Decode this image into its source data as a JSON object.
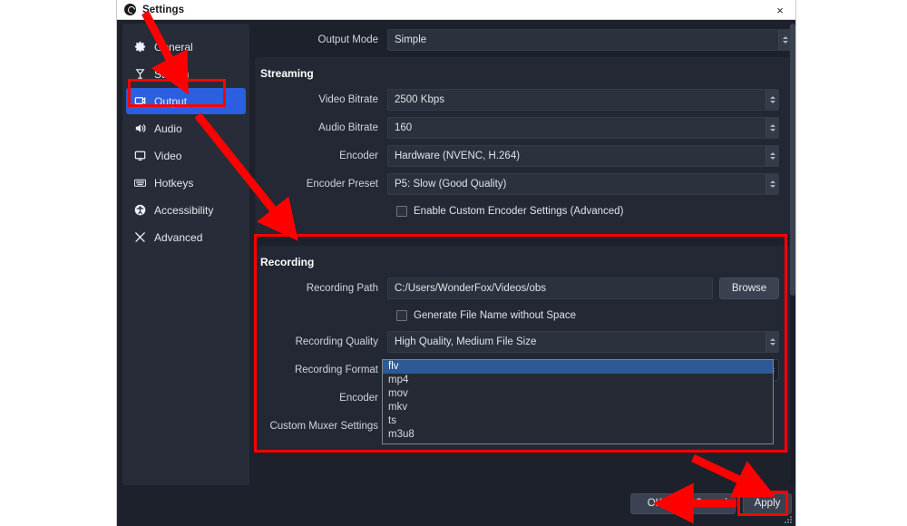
{
  "window": {
    "title": "Settings",
    "close_label": "×",
    "app_icon": "obs-logo-icon"
  },
  "sidebar": {
    "items": [
      {
        "label": "General",
        "icon": "gear-icon",
        "selected": false
      },
      {
        "label": "Stream",
        "icon": "broadcast-icon",
        "selected": false
      },
      {
        "label": "Output",
        "icon": "output-screen-icon",
        "selected": true
      },
      {
        "label": "Audio",
        "icon": "speaker-icon",
        "selected": false
      },
      {
        "label": "Video",
        "icon": "monitor-icon",
        "selected": false
      },
      {
        "label": "Hotkeys",
        "icon": "keyboard-icon",
        "selected": false
      },
      {
        "label": "Accessibility",
        "icon": "accessibility-icon",
        "selected": false
      },
      {
        "label": "Advanced",
        "icon": "tools-icon",
        "selected": false
      }
    ]
  },
  "output_mode": {
    "label": "Output Mode",
    "value": "Simple"
  },
  "streaming": {
    "heading": "Streaming",
    "video_bitrate": {
      "label": "Video Bitrate",
      "value": "2500 Kbps"
    },
    "audio_bitrate": {
      "label": "Audio Bitrate",
      "value": "160"
    },
    "encoder": {
      "label": "Encoder",
      "value": "Hardware (NVENC, H.264)"
    },
    "encoder_preset": {
      "label": "Encoder Preset",
      "value": "P5: Slow (Good Quality)"
    },
    "custom_encoder_checkbox": {
      "label": "Enable Custom Encoder Settings (Advanced)",
      "checked": false
    }
  },
  "recording": {
    "heading": "Recording",
    "path": {
      "label": "Recording Path",
      "value": "C:/Users/WonderFox/Videos/obs"
    },
    "browse_label": "Browse",
    "no_space_checkbox": {
      "label": "Generate File Name without Space",
      "checked": false
    },
    "quality": {
      "label": "Recording Quality",
      "value": "High Quality, Medium File Size"
    },
    "format": {
      "label": "Recording Format",
      "value": "flv"
    },
    "encoder_label": "Encoder",
    "custom_muxer_label": "Custom Muxer Settings"
  },
  "format_dropdown": {
    "open": true,
    "selected": "flv",
    "options": [
      "flv",
      "mp4",
      "mov",
      "mkv",
      "ts",
      "m3u8"
    ]
  },
  "footer": {
    "ok_label": "OK",
    "cancel_label": "Cancel",
    "apply_label": "Apply"
  },
  "annotations": {
    "color": "#ff0000",
    "boxes": [
      "output-sidebar-item",
      "recording-section",
      "apply-button"
    ],
    "arrows": [
      "titlebar-to-output",
      "output-to-recording",
      "to-apply",
      "apply-to-ok"
    ]
  }
}
